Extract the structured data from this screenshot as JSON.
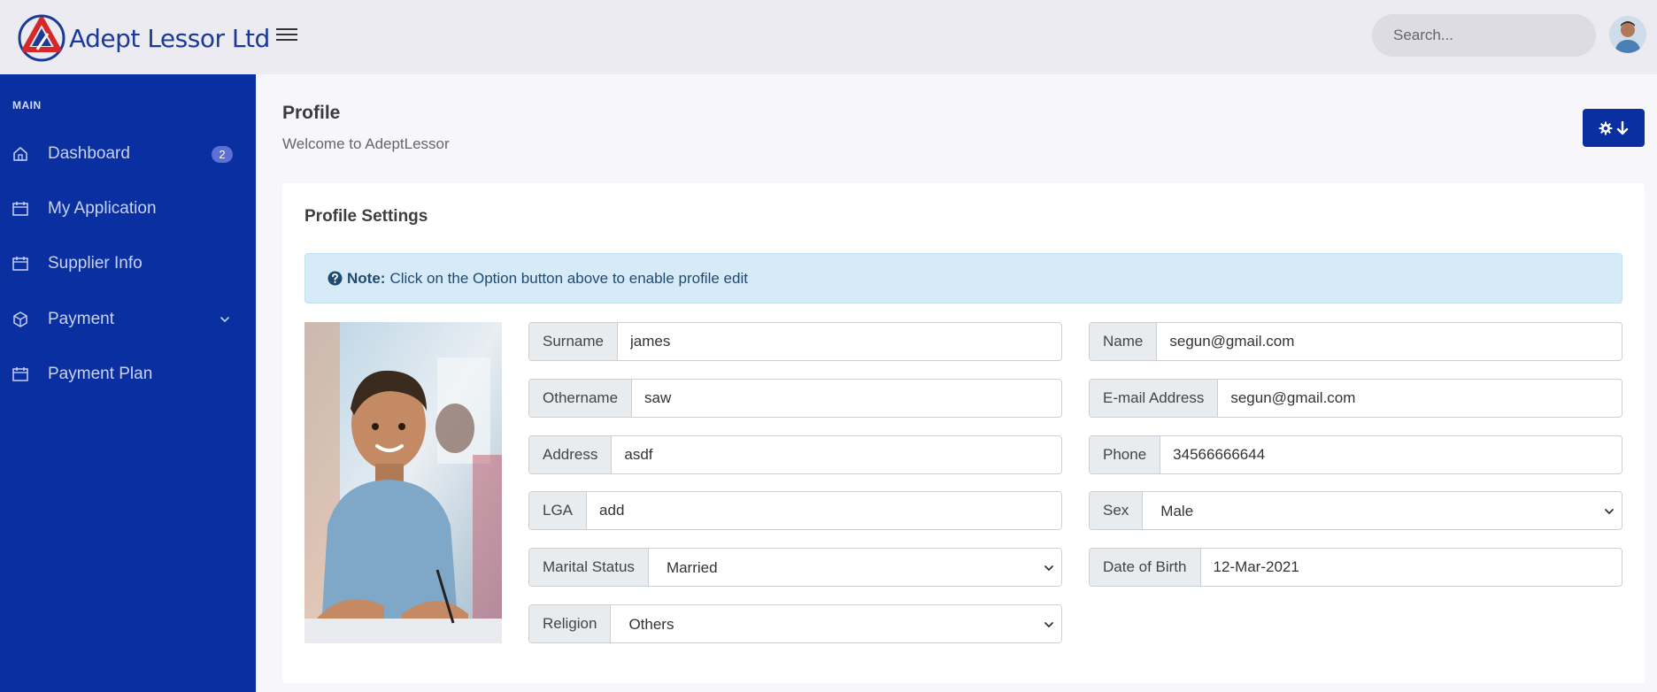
{
  "header": {
    "brand": "Adept Lessor Ltd",
    "search_placeholder": "Search..."
  },
  "sidebar": {
    "section": "MAIN",
    "items": [
      {
        "label": "Dashboard",
        "badge": "2"
      },
      {
        "label": "My Application"
      },
      {
        "label": "Supplier Info"
      },
      {
        "label": "Payment"
      },
      {
        "label": "Payment Plan"
      }
    ]
  },
  "page": {
    "title": "Profile",
    "subtitle": "Welcome to AdeptLessor"
  },
  "card": {
    "title": "Profile Settings",
    "note_bold": "Note:",
    "note_text": "Click on the Option button above to enable profile edit"
  },
  "form": {
    "surname": {
      "label": "Surname",
      "value": "james"
    },
    "othername": {
      "label": "Othername",
      "value": "saw"
    },
    "address": {
      "label": "Address",
      "value": "asdf"
    },
    "lga": {
      "label": "LGA",
      "value": "add"
    },
    "marital": {
      "label": "Marital Status",
      "value": "Married"
    },
    "religion": {
      "label": "Religion",
      "value": "Others"
    },
    "name": {
      "label": "Name",
      "value": "segun@gmail.com"
    },
    "email": {
      "label": "E-mail Address",
      "value": "segun@gmail.com"
    },
    "phone": {
      "label": "Phone",
      "value": "34566666644"
    },
    "sex": {
      "label": "Sex",
      "value": "Male"
    },
    "dob": {
      "label": "Date of Birth",
      "value": "12-Mar-2021"
    }
  },
  "colors": {
    "sidebar": "#0a2fa0",
    "header": "#ecebf1",
    "note_bg": "#d6eaf8",
    "badge": "#5e6fd6"
  }
}
